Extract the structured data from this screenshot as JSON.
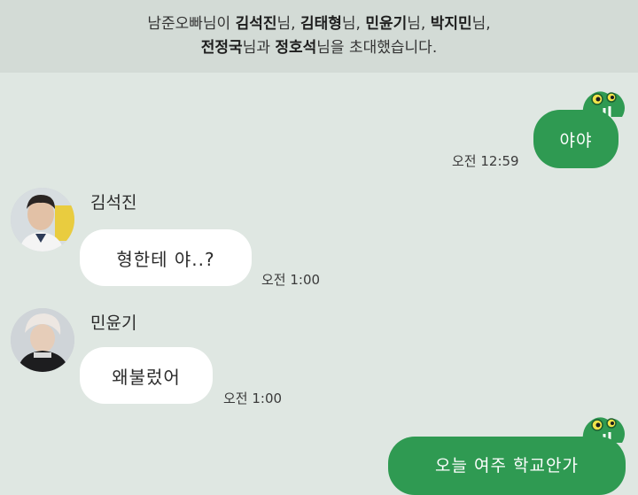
{
  "system_notice": {
    "line1": [
      {
        "text": "남준오빠님이 ",
        "bold": false
      },
      {
        "text": "김석진",
        "bold": true
      },
      {
        "text": "님, ",
        "bold": false
      },
      {
        "text": "김태형",
        "bold": true
      },
      {
        "text": "님, ",
        "bold": false
      },
      {
        "text": "민윤기",
        "bold": true
      },
      {
        "text": "님, ",
        "bold": false
      },
      {
        "text": "박지민",
        "bold": true
      },
      {
        "text": "님,",
        "bold": false
      }
    ],
    "line2": [
      {
        "text": "전정국",
        "bold": true
      },
      {
        "text": "님과 ",
        "bold": false
      },
      {
        "text": "정호석",
        "bold": true
      },
      {
        "text": "님을 초대했습니다.",
        "bold": false
      }
    ]
  },
  "messages": {
    "out1": {
      "text": "야야",
      "time": "오전 12:59"
    },
    "in1": {
      "sender": "김석진",
      "text": "형한테 야..?",
      "time": "오전 1:00"
    },
    "in2": {
      "sender": "민윤기",
      "text": "왜불렀어",
      "time": "오전 1:00"
    },
    "out2": {
      "text": "오늘 여주 학교안가"
    }
  },
  "colors": {
    "background": "#dfe7e2",
    "outgoing_bubble": "#2f9a52",
    "incoming_bubble": "#ffffff",
    "notice_bar": "#d3dbd6"
  }
}
